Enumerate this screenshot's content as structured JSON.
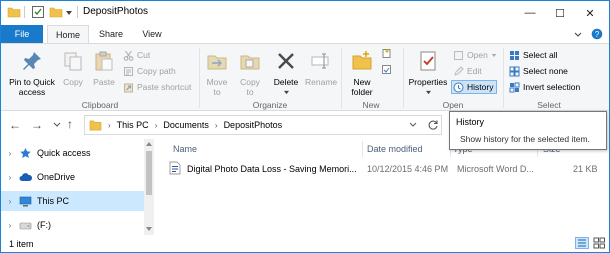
{
  "window": {
    "title": "DepositPhotos"
  },
  "window_controls": {
    "minimize": "—",
    "maximize": "☐",
    "close": "✕"
  },
  "ribbon_tabs": {
    "file": "File",
    "home": "Home",
    "share": "Share",
    "view": "View"
  },
  "ribbon": {
    "clipboard": {
      "label": "Clipboard",
      "pin_to_quick_access": "Pin to Quick\naccess",
      "copy": "Copy",
      "paste": "Paste",
      "cut": "Cut",
      "copy_path": "Copy path",
      "paste_shortcut": "Paste shortcut"
    },
    "organize": {
      "label": "Organize",
      "move_to": "Move\nto",
      "copy_to": "Copy\nto",
      "delete": "Delete",
      "rename": "Rename"
    },
    "new": {
      "label": "New",
      "new_folder": "New\nfolder"
    },
    "open": {
      "label": "Open",
      "properties": "Properties",
      "open": "Open",
      "edit": "Edit",
      "history": "History"
    },
    "select": {
      "label": "Select",
      "select_all": "Select all",
      "select_none": "Select none",
      "invert_selection": "Invert selection"
    }
  },
  "address": {
    "crumbs": [
      "This PC",
      "Documents",
      "DepositPhotos"
    ]
  },
  "tooltip": {
    "title": "History",
    "description": "Show history for the selected item."
  },
  "nav_pane": {
    "items": [
      {
        "label": "Quick access"
      },
      {
        "label": "OneDrive"
      },
      {
        "label": "This PC"
      },
      {
        "label": "(F:)"
      }
    ]
  },
  "file_list": {
    "columns": {
      "name": "Name",
      "date_modified": "Date modified",
      "type": "Type",
      "size": "Size"
    },
    "rows": [
      {
        "name": "Digital Photo Data Loss - Saving Memori...",
        "date": "10/12/2015 4:46 PM",
        "type": "Microsoft Word D...",
        "size": "21 KB"
      }
    ]
  },
  "status_bar": {
    "count": "1 item"
  },
  "colors": {
    "accent": "#1979ca",
    "selection": "#cce8ff",
    "folder": "#f0c24b"
  }
}
